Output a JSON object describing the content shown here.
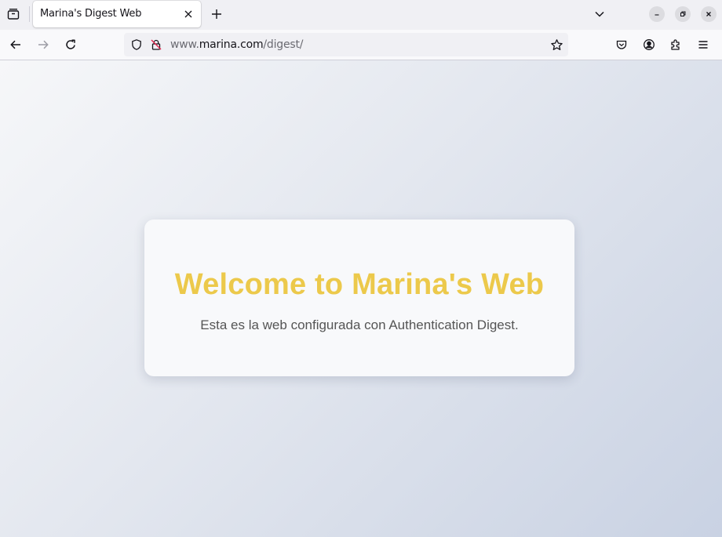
{
  "browser": {
    "tab": {
      "title": "Marina's Digest Web"
    },
    "url": {
      "prefix": "www.",
      "host": "marina.com",
      "path": "/digest/"
    },
    "icons": {
      "tab_list": "tab-list-icon",
      "tab_close": "close-icon",
      "new_tab": "plus-icon",
      "tab_overflow": "chevron-down-icon",
      "minimize": "minimize-icon",
      "restore": "restore-icon",
      "close_window": "close-icon",
      "back": "back-arrow-icon",
      "forward": "forward-arrow-icon",
      "reload": "reload-icon",
      "tracking_protection": "shield-icon",
      "insecure": "insecure-lock-icon",
      "bookmark": "star-icon",
      "pocket": "pocket-icon",
      "account": "account-icon",
      "extensions": "puzzle-icon",
      "menu": "hamburger-menu-icon"
    }
  },
  "page": {
    "heading": "Welcome to Marina's Web",
    "description": "Esta es la web configurada con Authentication Digest.",
    "heading_color": "#ecc94b",
    "text_color": "#555555"
  }
}
